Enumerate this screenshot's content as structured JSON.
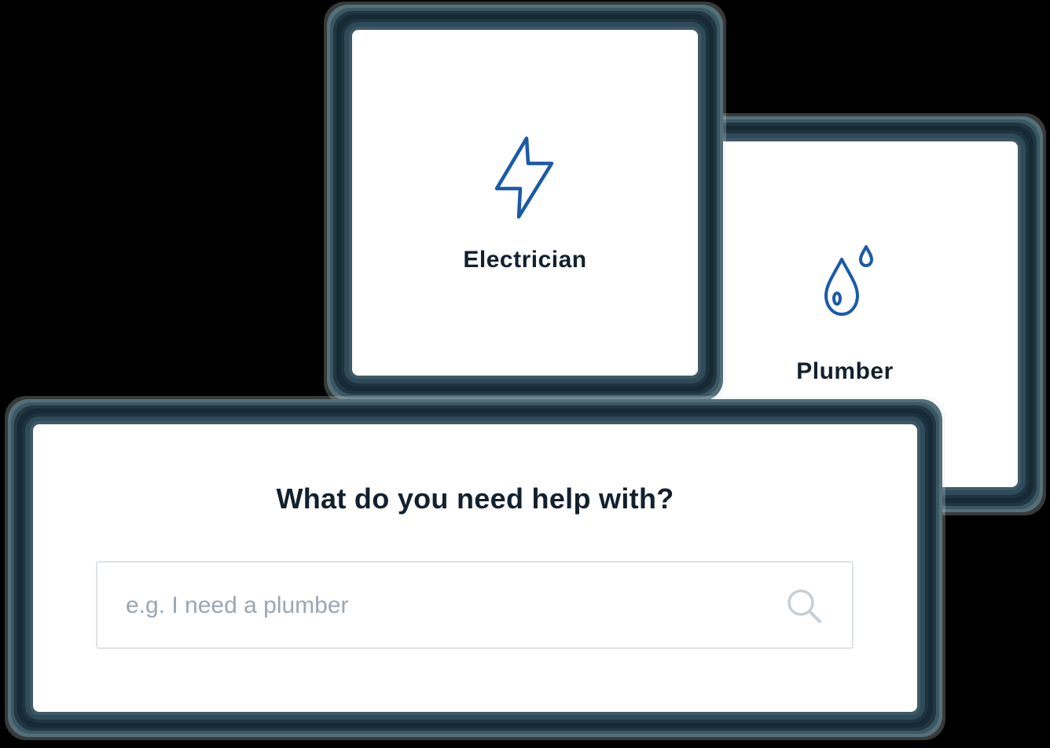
{
  "services": [
    {
      "label": "Electrician",
      "icon": "lightning-bolt-icon"
    },
    {
      "label": "Plumber",
      "icon": "water-drops-icon"
    }
  ],
  "search": {
    "title": "What do you need help with?",
    "placeholder": "e.g. I need a plumber",
    "value": "",
    "icon": "search-icon"
  },
  "colors": {
    "accent": "#1a5aa8",
    "text": "#13202e",
    "placeholder": "#9aa6b2",
    "border": "#dfe3e7"
  }
}
